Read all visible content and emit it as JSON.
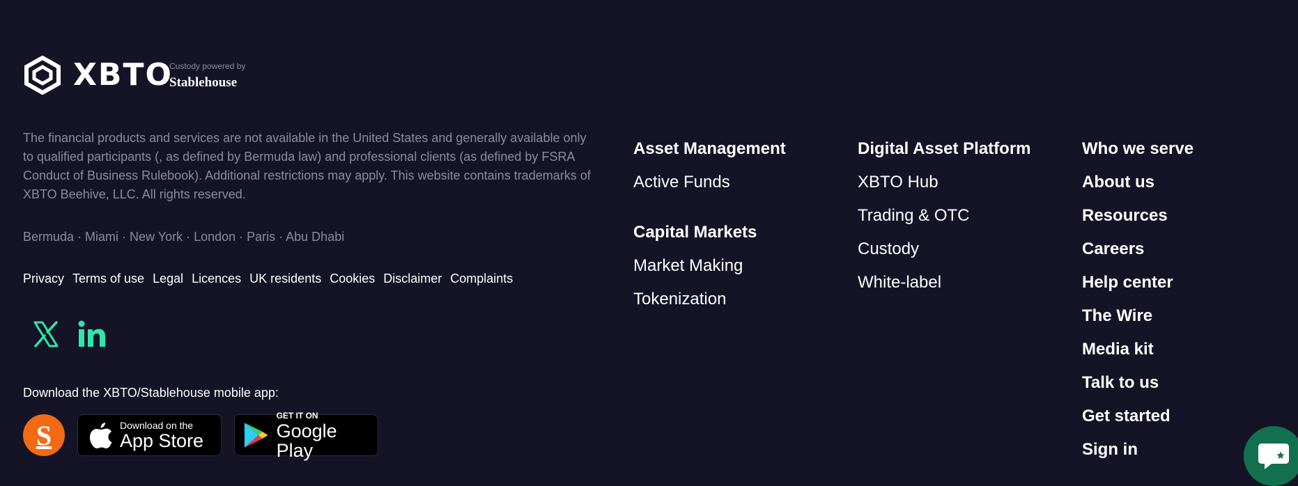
{
  "brand": {
    "logo_text": "XBTO",
    "custody_label": "Custody powered by",
    "custody_brand": "Stablehouse"
  },
  "disclaimer": "The financial products and services are not available in the United States and generally available only to qualified participants (, as defined by Bermuda law) and professional clients (as defined by FSRA Conduct of Business Rulebook). Additional restrictions may apply. This website contains trademarks of XBTO Beehive, LLC. All rights reserved.",
  "locations": "Bermuda · Miami · New York · London · Paris · Abu Dhabi",
  "legal_links": [
    "Privacy",
    "Terms of use",
    "Legal",
    "Licences",
    "UK residents",
    "Cookies",
    "Disclaimer",
    "Complaints"
  ],
  "social": {
    "x_icon": "x-twitter-icon",
    "linkedin_icon": "linkedin-icon",
    "accent_color": "#2ee6a8"
  },
  "download": {
    "label": "Download the XBTO/Stablehouse mobile app:",
    "stablehouse_letter": "S",
    "app_store_small": "Download on the",
    "app_store_big": "App Store",
    "google_play_small": "GET IT ON",
    "google_play_big": "Google Play"
  },
  "nav": {
    "col1": {
      "asset_management": "Asset Management",
      "active_funds": "Active Funds",
      "capital_markets": "Capital Markets",
      "market_making": "Market Making",
      "tokenization": "Tokenization"
    },
    "col2": {
      "digital_asset_platform": "Digital Asset Platform",
      "xbto_hub": "XBTO Hub",
      "trading_otc": "Trading & OTC",
      "custody": "Custody",
      "white_label": "White-label"
    },
    "col3": [
      "Who we serve",
      "About us",
      "Resources",
      "Careers",
      "Help center",
      "The Wire",
      "Media kit",
      "Talk to us",
      "Get started",
      "Sign in"
    ]
  },
  "colors": {
    "background": "#151427",
    "muted_text": "#8d8b9c",
    "chat_button": "#12704f",
    "stablehouse_orange": "#f26a13"
  }
}
